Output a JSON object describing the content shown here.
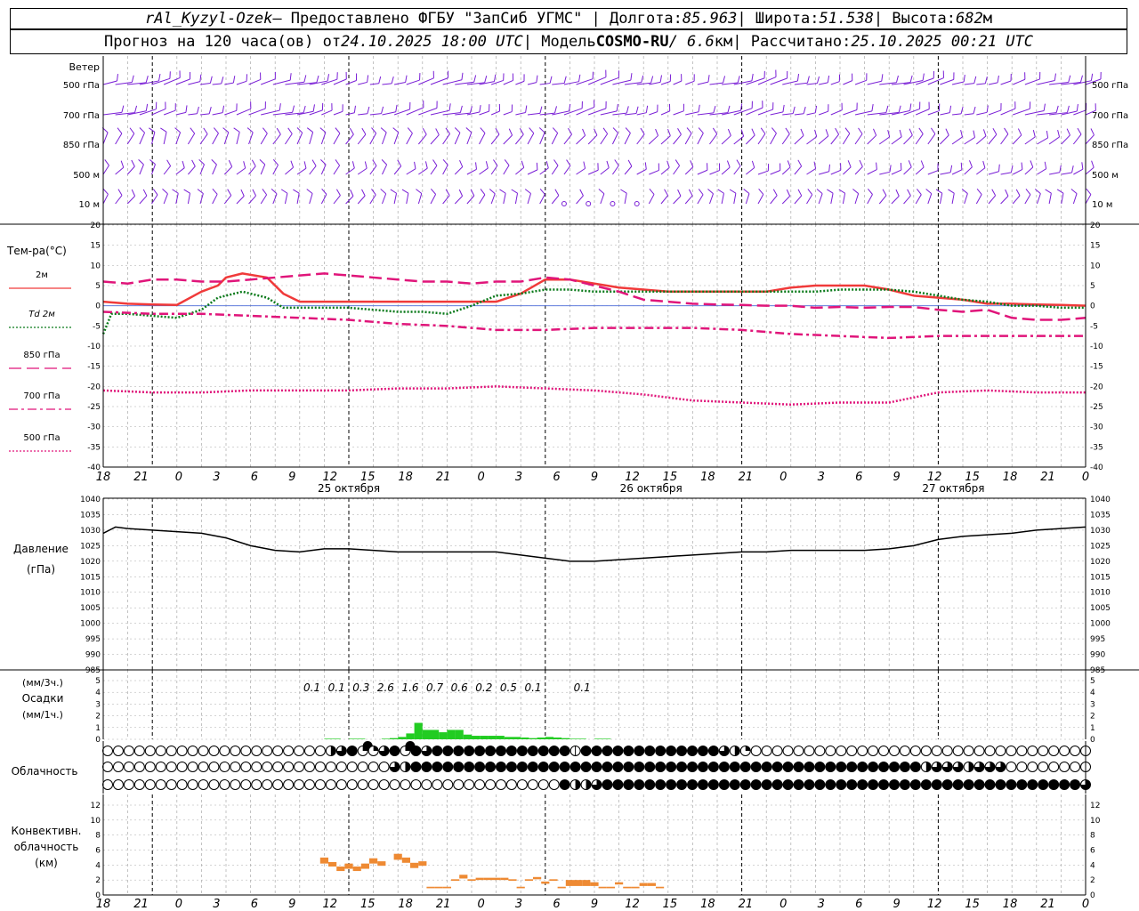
{
  "header": {
    "line1": {
      "station": "rAl_Kyzyl-Ozek",
      "provided": " — Предоставлено ФГБУ \"ЗапСиб УГМС\" | Долгота: ",
      "lon": "85.963",
      "lat_label": " | Широта: ",
      "lat": "51.538",
      "alt_label": " | Высота: ",
      "alt": "682",
      "alt_unit": "м"
    },
    "line2": {
      "forecast_label": "Прогноз на 120 часа(ов) от ",
      "forecast_time": "24.10.2025 18:00 UTC",
      "model_label": " | Модель ",
      "model": "COSMO-RU",
      "res": " / 6.6",
      "res_unit": "км",
      "calc_label": " | Рассчитано: ",
      "calc_time": "25.10.2025 00:21 UTC"
    }
  },
  "colors": {
    "wind": "#7a1fd6",
    "t2m": "#f03a3a",
    "td2m": "#0a7a1a",
    "t850": "#e0157a",
    "precip": "#22cc22",
    "conv": "#ee8a33",
    "grid": "#aaaaaa"
  },
  "time_axis": {
    "hour_labels": [
      "18",
      "21",
      "0",
      "3",
      "6",
      "9",
      "12",
      "15",
      "18",
      "21",
      "0",
      "3",
      "6",
      "9",
      "12",
      "15",
      "18",
      "21",
      "0",
      "3",
      "6",
      "9",
      "12",
      "15",
      "18",
      "21",
      "0"
    ],
    "date_labels": [
      "25 октября",
      "26 октября",
      "27 октября"
    ]
  },
  "wind_panel": {
    "title": "Ветер",
    "levels": [
      "500 гПа",
      "700 гПа",
      "850 гПа",
      "500 м",
      "10 м"
    ]
  },
  "temp_panel": {
    "title": "Тем-ра(°C)",
    "ylim": [
      -40,
      20
    ],
    "ticks": [
      "20",
      "15",
      "10",
      "5",
      "0",
      "-5",
      "-10",
      "-15",
      "-20",
      "-25",
      "-30",
      "-35",
      "-40"
    ],
    "legend": [
      {
        "id": "t2m",
        "label": "2м",
        "color": "#f03a3a",
        "style": "solid"
      },
      {
        "id": "td2m",
        "prefix": "Td",
        "label": "2м",
        "color": "#0a7a1a",
        "style": "dotted"
      },
      {
        "id": "t850",
        "label": "850 гПа",
        "color": "#e0157a",
        "style": "longdash"
      },
      {
        "id": "t700",
        "label": "700 гПа",
        "color": "#e0157a",
        "style": "dashdot"
      },
      {
        "id": "t500",
        "label": "500 гПа",
        "color": "#e0157a",
        "style": "dot"
      }
    ]
  },
  "pressure_panel": {
    "title": "Давление",
    "unit": "(гПа)",
    "ylim": [
      985,
      1040
    ],
    "ticks": [
      "1040",
      "1035",
      "1030",
      "1025",
      "1020",
      "1015",
      "1010",
      "1005",
      "1000",
      "995",
      "990",
      "985"
    ]
  },
  "precip_panel": {
    "unit3": "(мм/3ч.)",
    "title": "Осадки",
    "unit1": "(мм/1ч.)",
    "ticks": [
      "5",
      "4",
      "3",
      "2",
      "1",
      "0"
    ],
    "labels": [
      {
        "h": 27,
        "text": "0.1"
      },
      {
        "h": 30,
        "text": "0.1"
      },
      {
        "h": 33,
        "text": "0.3"
      },
      {
        "h": 36,
        "text": "2.6"
      },
      {
        "h": 39,
        "text": "1.6"
      },
      {
        "h": 42,
        "text": "0.7"
      },
      {
        "h": 45,
        "text": "0.6"
      },
      {
        "h": 48,
        "text": "0.2"
      },
      {
        "h": 51,
        "text": "0.5"
      },
      {
        "h": 54,
        "text": "0.1"
      },
      {
        "h": 60,
        "text": "0.1"
      }
    ]
  },
  "cloud_panel": {
    "title": "Облачность",
    "rows": [
      "000000000000000000000234513454344444444444448444444444444432100000000000000000000000000000000",
      "000000000000000000000000000324444444444444444444444444444444444444444444444442333233300000000",
      "000000000000000000000000000000000000000000042234444444444444444444444444444444444444444444443"
    ]
  },
  "conv_panel": {
    "title1": "Конвективн.",
    "title2": "облачность",
    "unit": "(км)",
    "ticks": [
      "12",
      "10",
      "8",
      "6",
      "4",
      "2",
      "0"
    ]
  },
  "chart_data": [
    {
      "type": "line",
      "title": "Тем-ра(°C)",
      "x_unit": "hours from 24.10.2025 18:00 UTC",
      "ylim": [
        -40,
        20
      ],
      "series": [
        {
          "name": "2м",
          "x": [
            0,
            3,
            6,
            9,
            12,
            14,
            15,
            17,
            20,
            22,
            24,
            25,
            27,
            30,
            33,
            35,
            36,
            39,
            42,
            45,
            48,
            51,
            54,
            57,
            60,
            63,
            66,
            69,
            72,
            75,
            78,
            81,
            84,
            87,
            90,
            93,
            96,
            99,
            102,
            105,
            108,
            111,
            114,
            117,
            120
          ],
          "y": [
            1,
            0.5,
            0.3,
            0.2,
            3.5,
            5,
            7,
            8,
            7,
            3,
            1,
            1,
            1,
            1,
            1,
            1,
            1,
            1,
            1,
            1,
            1,
            3,
            6.5,
            6.5,
            5.5,
            4.5,
            4,
            3.5,
            3.5,
            3.5,
            3.5,
            3.5,
            4.5,
            5,
            5,
            5,
            4,
            2.5,
            2,
            1.5,
            0.5,
            0.5,
            0.3,
            0.2,
            0
          ]
        },
        {
          "name": "Td 2м",
          "x": [
            0,
            1,
            3,
            6,
            9,
            12,
            14,
            17,
            20,
            22,
            24,
            27,
            30,
            33,
            36,
            39,
            42,
            45,
            48,
            51,
            54,
            57,
            60,
            63,
            66,
            69,
            72,
            75,
            78,
            81,
            84,
            87,
            90,
            93,
            96,
            99,
            102,
            105,
            108,
            111,
            114,
            117,
            120
          ],
          "y": [
            -7,
            -2,
            -2,
            -2.5,
            -3,
            -1,
            2,
            3.5,
            2,
            -0.5,
            -0.5,
            -0.5,
            -0.5,
            -1,
            -1.5,
            -1.5,
            -2,
            0,
            2.5,
            3,
            4,
            4,
            3.5,
            3.5,
            3.5,
            3.5,
            3.5,
            3.5,
            3.5,
            3.5,
            3.5,
            3.5,
            4,
            4,
            4,
            3.5,
            2.5,
            1.5,
            1,
            0,
            0,
            -0.5,
            -0.5
          ]
        },
        {
          "name": "850 гПа",
          "x": [
            0,
            3,
            6,
            9,
            12,
            15,
            18,
            21,
            24,
            27,
            30,
            33,
            36,
            39,
            42,
            45,
            48,
            51,
            54,
            57,
            60,
            63,
            66,
            69,
            72,
            75,
            78,
            81,
            84,
            87,
            90,
            93,
            96,
            99,
            102,
            105,
            108,
            111,
            114,
            117,
            120
          ],
          "y": [
            6,
            5.5,
            6.5,
            6.5,
            6,
            6,
            6.5,
            7,
            7.5,
            8,
            7.5,
            7,
            6.5,
            6,
            6,
            5.5,
            6,
            6,
            7,
            6.5,
            5,
            3.5,
            1.5,
            1,
            0.5,
            0.3,
            0.2,
            0,
            0,
            -0.5,
            -0.3,
            -0.5,
            -0.3,
            -0.3,
            -1,
            -1.5,
            -1,
            -3,
            -3.5,
            -3.5,
            -3
          ]
        },
        {
          "name": "700 гПа",
          "x": [
            0,
            6,
            12,
            18,
            24,
            30,
            36,
            42,
            48,
            54,
            60,
            66,
            72,
            78,
            84,
            90,
            96,
            102,
            108,
            114,
            120
          ],
          "y": [
            -1.5,
            -2,
            -2,
            -2.5,
            -3,
            -3.5,
            -4.5,
            -5,
            -6,
            -6,
            -5.5,
            -5.5,
            -5.5,
            -6,
            -7,
            -7.5,
            -8,
            -7.5,
            -7.5,
            -7.5,
            -7.5
          ]
        },
        {
          "name": "500 гПа",
          "x": [
            0,
            6,
            12,
            18,
            24,
            30,
            36,
            42,
            48,
            54,
            60,
            66,
            72,
            78,
            84,
            90,
            96,
            102,
            108,
            114,
            120
          ],
          "y": [
            -21,
            -21.5,
            -21.5,
            -21,
            -21,
            -21,
            -20.5,
            -20.5,
            -20,
            -20.5,
            -21,
            -22,
            -23.5,
            -24,
            -24.5,
            -24,
            -24,
            -21.5,
            -21,
            -21.5,
            -21.5
          ]
        }
      ]
    },
    {
      "type": "line",
      "title": "Давление",
      "x_unit": "hours from 24.10.2025 18:00 UTC",
      "ylim": [
        985,
        1040
      ],
      "series": [
        {
          "name": "Давление",
          "x": [
            0,
            1.5,
            3,
            6,
            9,
            12,
            15,
            18,
            21,
            24,
            27,
            30,
            33,
            36,
            39,
            42,
            45,
            48,
            51,
            54,
            57,
            60,
            63,
            66,
            69,
            72,
            75,
            78,
            81,
            84,
            87,
            90,
            93,
            96,
            99,
            102,
            105,
            108,
            111,
            114,
            117,
            120
          ],
          "y": [
            1029,
            1031,
            1030.5,
            1030,
            1029.5,
            1029,
            1027.5,
            1025,
            1023.5,
            1023,
            1024,
            1024,
            1023.5,
            1023,
            1023,
            1023,
            1023,
            1023,
            1022,
            1021,
            1020,
            1020,
            1020.5,
            1021,
            1021.5,
            1022,
            1022.5,
            1023,
            1023,
            1023.5,
            1023.5,
            1023.5,
            1023.5,
            1024,
            1025,
            1027,
            1028,
            1028.5,
            1029,
            1030,
            1030.5,
            1031
          ]
        }
      ]
    },
    {
      "type": "bar",
      "title": "Осадки",
      "x_unit": "hours from 24.10.2025 18:00 UTC",
      "ylim": [
        0,
        5
      ],
      "hourly_x": [
        28,
        29,
        30,
        31,
        32,
        33,
        34,
        35,
        36,
        37,
        38,
        39,
        40,
        41,
        42,
        43,
        44,
        45,
        46,
        47,
        48,
        49,
        50,
        51,
        52,
        53,
        54,
        55,
        56,
        57,
        58,
        59,
        60,
        61,
        62
      ],
      "hourly_mm": [
        0.05,
        0.05,
        0,
        0.05,
        0.05,
        0,
        0,
        0.05,
        0.1,
        0.2,
        0.5,
        1.4,
        0.8,
        0.8,
        0.6,
        0.8,
        0.8,
        0.4,
        0.3,
        0.3,
        0.3,
        0.3,
        0.2,
        0.2,
        0.15,
        0.1,
        0.15,
        0.2,
        0.15,
        0.1,
        0.05,
        0.05,
        0,
        0.05,
        0.05
      ]
    },
    {
      "type": "bar",
      "title": "Конвективн. облачность",
      "x_unit": "hours from 24.10.2025 18:00 UTC",
      "ylim": [
        0,
        12
      ],
      "segments": [
        {
          "x0": 36,
          "x1": 37,
          "bottom": 4.2,
          "top": 5
        },
        {
          "x0": 37,
          "x1": 38,
          "bottom": 3.8,
          "top": 4.4
        },
        {
          "x0": 38,
          "x1": 39,
          "bottom": 3.2,
          "top": 3.8
        },
        {
          "x0": 39,
          "x1": 40,
          "bottom": 3.5,
          "top": 4.2
        },
        {
          "x0": 40,
          "x1": 41,
          "bottom": 3.2,
          "top": 3.8
        },
        {
          "x0": 41,
          "x1": 42,
          "bottom": 3.5,
          "top": 4.2
        },
        {
          "x0": 42,
          "x1": 43,
          "bottom": 4.2,
          "top": 4.9
        },
        {
          "x0": 43,
          "x1": 44,
          "bottom": 3.9,
          "top": 4.5
        },
        {
          "x0": 45,
          "x1": 46,
          "bottom": 4.7,
          "top": 5.5
        },
        {
          "x0": 46,
          "x1": 47,
          "bottom": 4.3,
          "top": 5
        },
        {
          "x0": 47,
          "x1": 48,
          "bottom": 3.6,
          "top": 4.3
        },
        {
          "x0": 48,
          "x1": 49,
          "bottom": 3.9,
          "top": 4.5
        },
        {
          "x0": 49,
          "x1": 50,
          "bottom": 0.9,
          "top": 1.1
        },
        {
          "x0": 50,
          "x1": 51,
          "bottom": 0.9,
          "top": 1.1
        },
        {
          "x0": 51,
          "x1": 52,
          "bottom": 0.9,
          "top": 1.1
        },
        {
          "x0": 52,
          "x1": 53,
          "bottom": 1.9,
          "top": 2.1
        },
        {
          "x0": 53,
          "x1": 54,
          "bottom": 2.2,
          "top": 2.7
        },
        {
          "x0": 54,
          "x1": 55,
          "bottom": 1.9,
          "top": 2.1
        },
        {
          "x0": 55,
          "x1": 56,
          "bottom": 2,
          "top": 2.3
        },
        {
          "x0": 56,
          "x1": 57,
          "bottom": 2,
          "top": 2.3
        },
        {
          "x0": 57,
          "x1": 58,
          "bottom": 2,
          "top": 2.3
        },
        {
          "x0": 58,
          "x1": 59,
          "bottom": 2,
          "top": 2.3
        },
        {
          "x0": 59,
          "x1": 60,
          "bottom": 1.9,
          "top": 2.1
        },
        {
          "x0": 60,
          "x1": 61,
          "bottom": 0.9,
          "top": 1.1
        },
        {
          "x0": 61,
          "x1": 62,
          "bottom": 1.9,
          "top": 2.1
        },
        {
          "x0": 62,
          "x1": 63,
          "bottom": 2.1,
          "top": 2.4
        },
        {
          "x0": 63,
          "x1": 64,
          "bottom": 1.5,
          "top": 1.8
        },
        {
          "x0": 64,
          "x1": 65,
          "bottom": 1.9,
          "top": 2.1
        },
        {
          "x0": 65,
          "x1": 66,
          "bottom": 0.9,
          "top": 1.1
        },
        {
          "x0": 66,
          "x1": 67,
          "bottom": 1.2,
          "top": 2
        },
        {
          "x0": 67,
          "x1": 68,
          "bottom": 1.2,
          "top": 2
        },
        {
          "x0": 68,
          "x1": 69,
          "bottom": 1.2,
          "top": 2
        },
        {
          "x0": 69,
          "x1": 70,
          "bottom": 1.2,
          "top": 1.7
        },
        {
          "x0": 70,
          "x1": 71,
          "bottom": 0.9,
          "top": 1.1
        },
        {
          "x0": 71,
          "x1": 72,
          "bottom": 0.9,
          "top": 1.1
        },
        {
          "x0": 72,
          "x1": 73,
          "bottom": 1.4,
          "top": 1.7
        },
        {
          "x0": 73,
          "x1": 74,
          "bottom": 0.9,
          "top": 1.1
        },
        {
          "x0": 74,
          "x1": 75,
          "bottom": 0.9,
          "top": 1.1
        },
        {
          "x0": 75,
          "x1": 76,
          "bottom": 1.2,
          "top": 1.6
        },
        {
          "x0": 76,
          "x1": 77,
          "bottom": 1.2,
          "top": 1.6
        },
        {
          "x0": 77,
          "x1": 78,
          "bottom": 0.9,
          "top": 1.1
        }
      ]
    }
  ]
}
